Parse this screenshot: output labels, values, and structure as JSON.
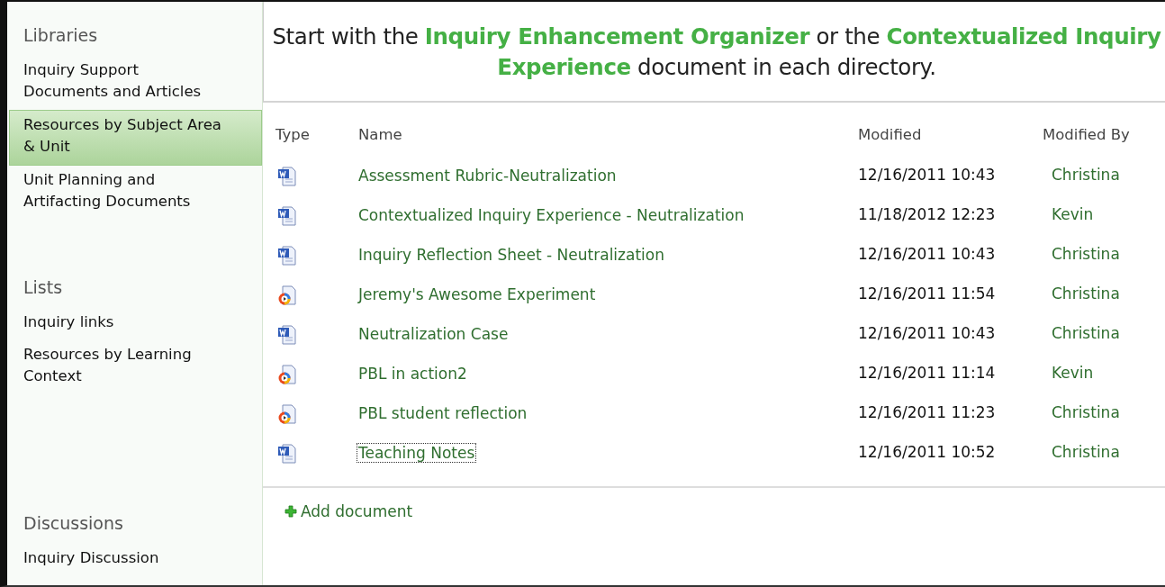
{
  "sidebar": {
    "sections": [
      {
        "heading": "Libraries",
        "items": [
          {
            "label": "Inquiry Support Documents and Articles",
            "selected": false
          },
          {
            "label": "Resources by Subject Area & Unit",
            "selected": true
          },
          {
            "label": "Unit Planning and Artifacting Documents",
            "selected": false
          }
        ]
      },
      {
        "heading": "Lists",
        "items": [
          {
            "label": "Inquiry links",
            "selected": false
          },
          {
            "label": "Resources by Learning Context",
            "selected": false
          }
        ]
      },
      {
        "heading": "Discussions",
        "items": [
          {
            "label": "Inquiry Discussion",
            "selected": false
          }
        ]
      }
    ]
  },
  "intro": "Start with the  **Inquiry Enhancement Organizer** or the **Contextualized Inquiry Experience** document in each directory.",
  "table": {
    "columns": [
      "Type",
      "Name",
      "Modified",
      "Modified By"
    ],
    "rows": [
      {
        "kind": "word",
        "name": "Assessment Rubric-Neutralization",
        "modified": "12/16/2011 10:43",
        "modified_by": "Christina",
        "focused": false
      },
      {
        "kind": "word",
        "name": "Contextualized Inquiry Experience - Neutralization",
        "modified": "11/18/2012 12:23",
        "modified_by": "Kevin",
        "focused": false
      },
      {
        "kind": "word",
        "name": "Inquiry Reflection Sheet - Neutralization",
        "modified": "12/16/2011 10:43",
        "modified_by": "Christina",
        "focused": false
      },
      {
        "kind": "media",
        "name": "Jeremy's Awesome Experiment",
        "modified": "12/16/2011 11:54",
        "modified_by": "Christina",
        "focused": false
      },
      {
        "kind": "word",
        "name": "Neutralization Case",
        "modified": "12/16/2011 10:43",
        "modified_by": "Christina",
        "focused": false
      },
      {
        "kind": "media",
        "name": "PBL in action2",
        "modified": "12/16/2011 11:14",
        "modified_by": "Kevin",
        "focused": false
      },
      {
        "kind": "media",
        "name": "PBL student reflection",
        "modified": "12/16/2011 11:23",
        "modified_by": "Christina",
        "focused": false
      },
      {
        "kind": "word",
        "name": "Teaching Notes",
        "modified": "12/16/2011 10:52",
        "modified_by": "Christina",
        "focused": true
      }
    ]
  },
  "add_link": "Add document"
}
